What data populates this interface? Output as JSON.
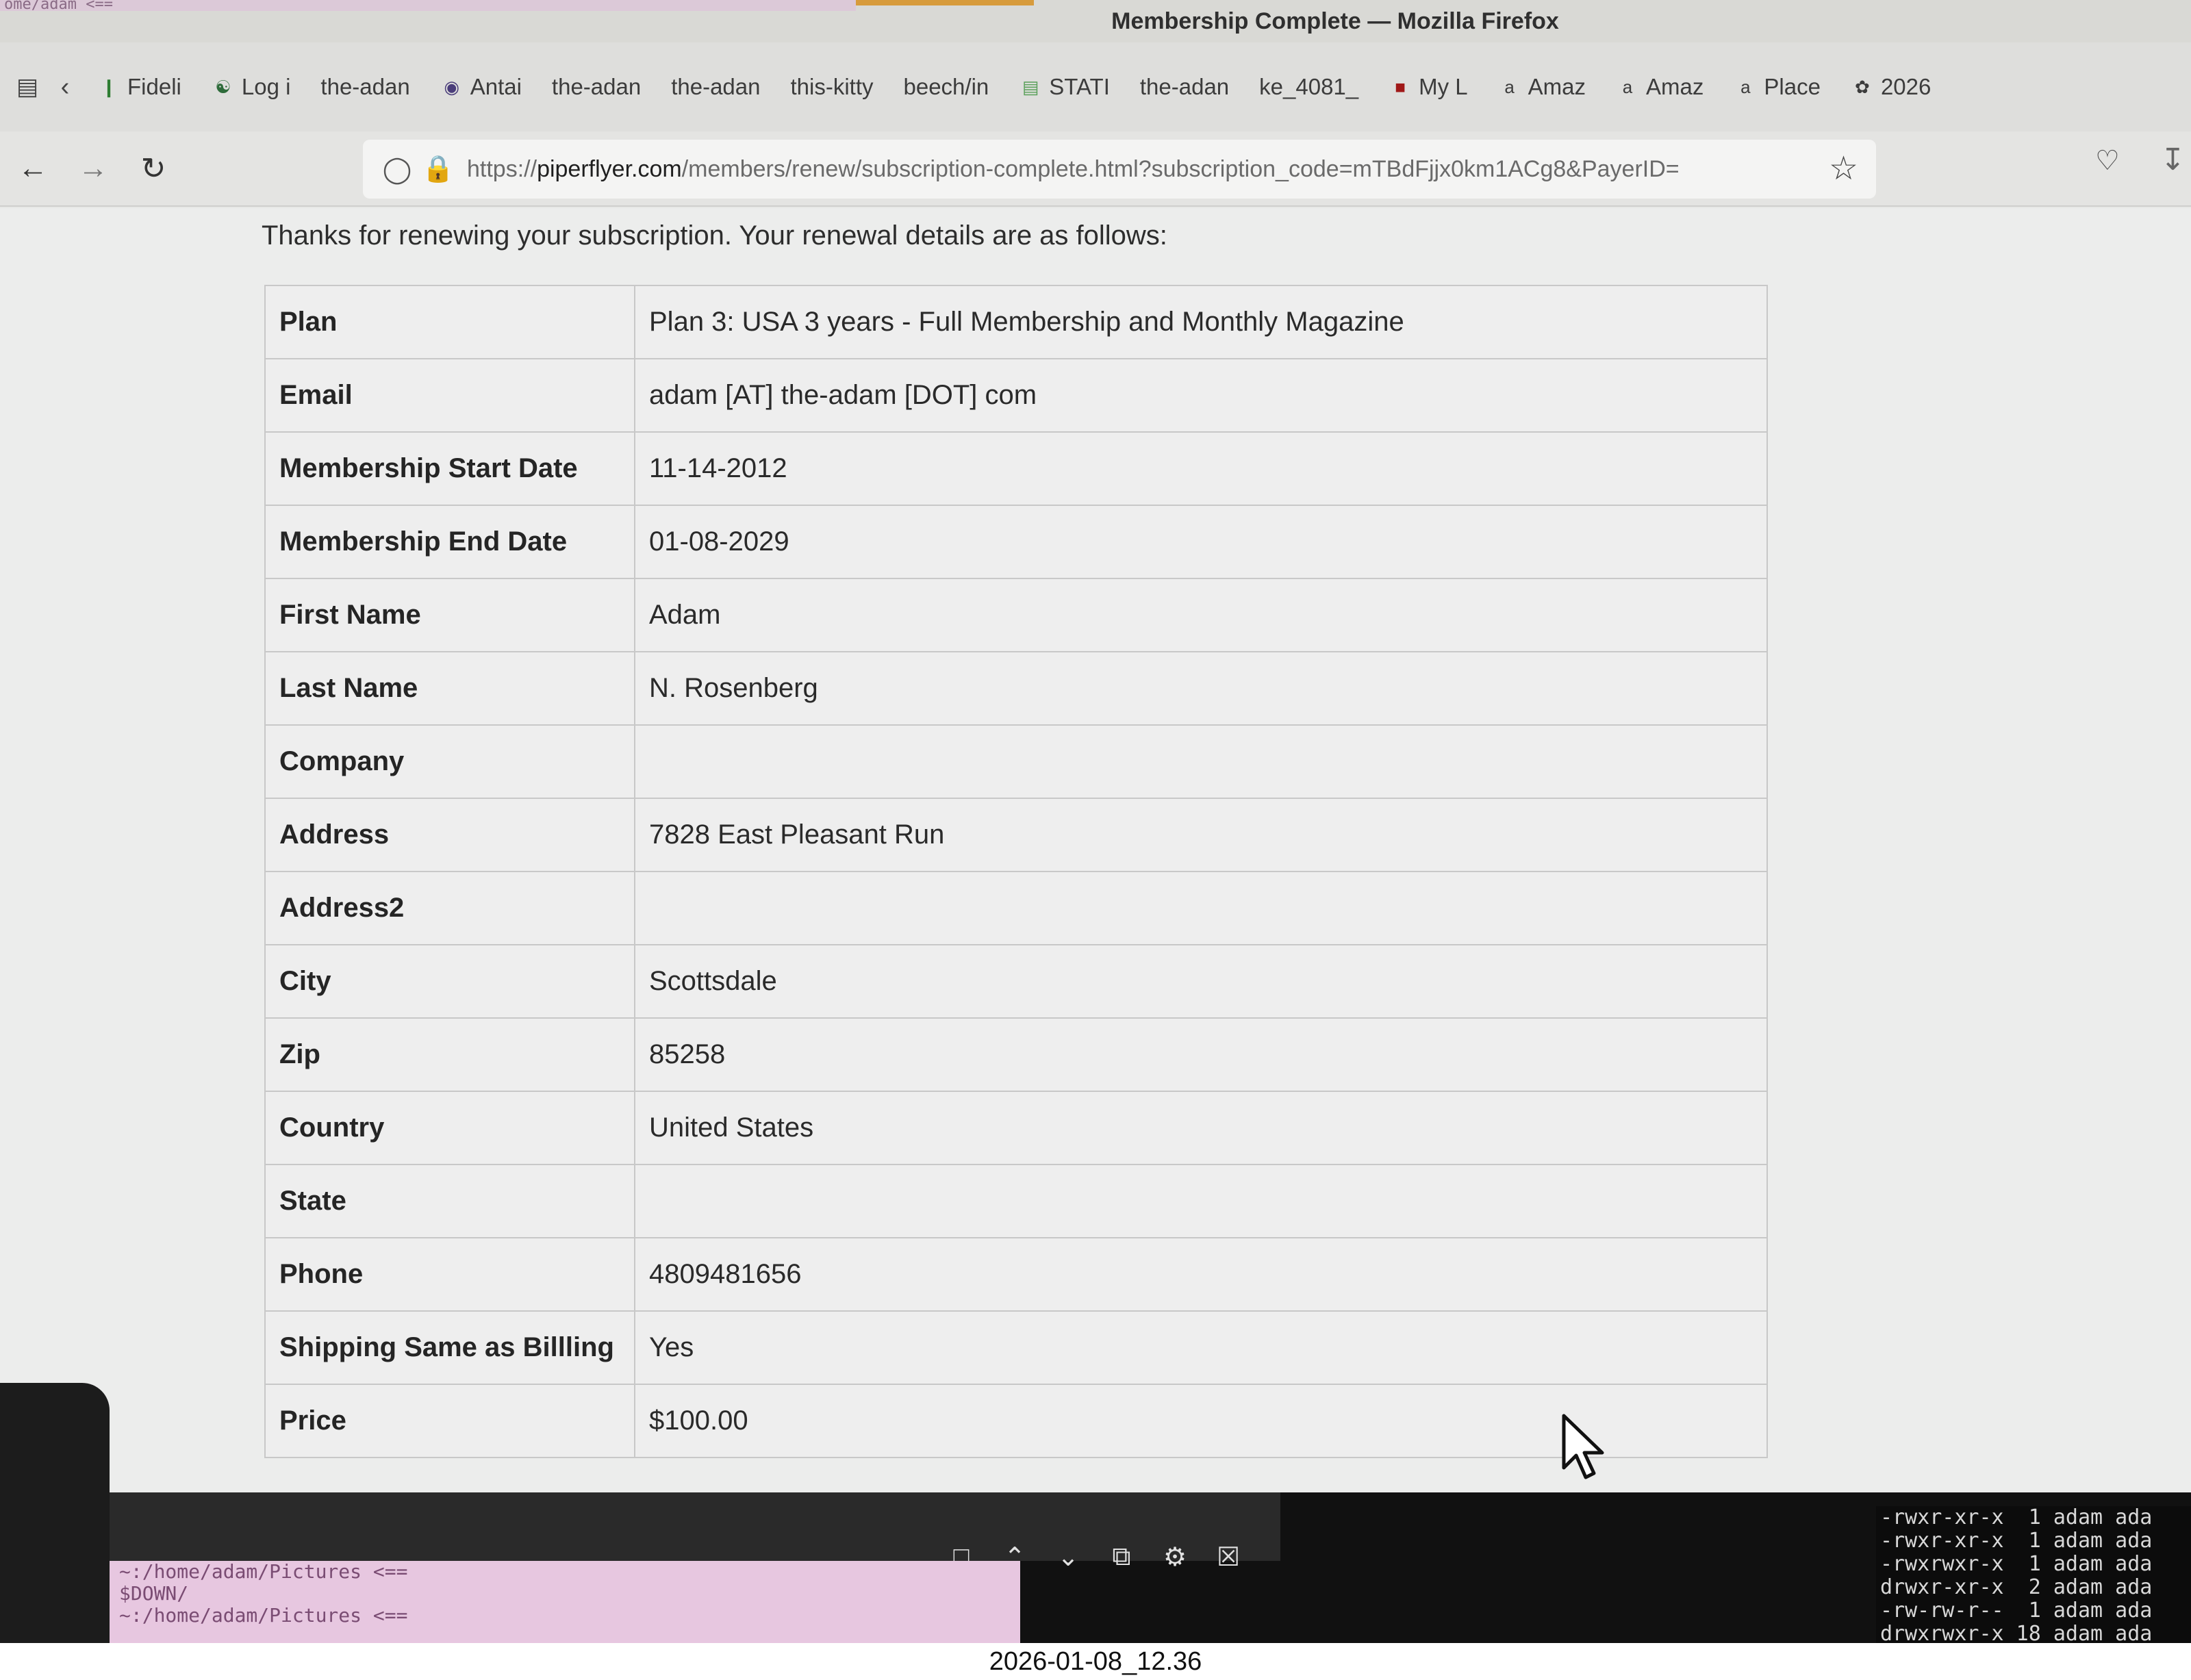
{
  "window": {
    "title": "Membership Complete — Mozilla Firefox",
    "terminal_title_fragment": "ome/adam  <=="
  },
  "tabs": [
    {
      "label": "Fideli",
      "icon": "green-bar-icon"
    },
    {
      "label": "Log i",
      "icon": "spinner-icon"
    },
    {
      "label": "the-adan",
      "icon": ""
    },
    {
      "label": "Antai",
      "icon": "wiki-icon"
    },
    {
      "label": "the-adan",
      "icon": ""
    },
    {
      "label": "the-adan",
      "icon": ""
    },
    {
      "label": "this-kitty",
      "icon": ""
    },
    {
      "label": "beech/in",
      "icon": ""
    },
    {
      "label": "STATI",
      "icon": "stats-icon"
    },
    {
      "label": "the-adan",
      "icon": ""
    },
    {
      "label": "ke_4081_",
      "icon": ""
    },
    {
      "label": "My L",
      "icon": "red-icon"
    },
    {
      "label": "Amaz",
      "icon": "amazon-icon"
    },
    {
      "label": "Amaz",
      "icon": "amazon-icon"
    },
    {
      "label": "Place",
      "icon": "amazon-icon"
    },
    {
      "label": "2026",
      "icon": "bug-icon"
    }
  ],
  "navbar": {
    "url_prefix": "https://",
    "url_host": "piperflyer.com",
    "url_path": "/members/renew/subscription-complete.html?subscription_code=mTBdFjjx0km1ACg8&PayerID="
  },
  "page": {
    "intro": "Thanks for renewing your subscription. Your renewal details are as follows:",
    "rows": [
      {
        "key": "Plan",
        "value": "Plan 3: USA 3 years - Full Membership and Monthly Magazine"
      },
      {
        "key": "Email",
        "value": "adam [AT] the-adam [DOT] com"
      },
      {
        "key": "Membership Start Date",
        "value": "11-14-2012"
      },
      {
        "key": "Membership End Date",
        "value": "01-08-2029"
      },
      {
        "key": "First Name",
        "value": "Adam"
      },
      {
        "key": "Last Name",
        "value": "N. Rosenberg"
      },
      {
        "key": "Company",
        "value": ""
      },
      {
        "key": "Address",
        "value": "7828 East Pleasant Run"
      },
      {
        "key": "Address2",
        "value": ""
      },
      {
        "key": "City",
        "value": "Scottsdale"
      },
      {
        "key": "Zip",
        "value": "85258"
      },
      {
        "key": "Country",
        "value": "United States"
      },
      {
        "key": "State",
        "value": ""
      },
      {
        "key": "Phone",
        "value": "4809481656"
      },
      {
        "key": "Shipping Same as Billling",
        "value": "Yes"
      },
      {
        "key": "Price",
        "value": "$100.00"
      }
    ]
  },
  "terminal": {
    "lines": [
      "~:/home/adam/Pictures <==",
      "$DOWN/",
      "~:/home/adam/Pictures <=="
    ],
    "ls_lines": [
      "-rwxr-xr-x  1 adam ada",
      "-rwxr-xr-x  1 adam ada",
      "-rwxrwxr-x  1 adam ada",
      "drwxr-xr-x  2 adam ada",
      "-rw-rw-r--  1 adam ada",
      "drwxrwxr-x 18 adam ada"
    ]
  },
  "caption": "2026-01-08_12.36"
}
